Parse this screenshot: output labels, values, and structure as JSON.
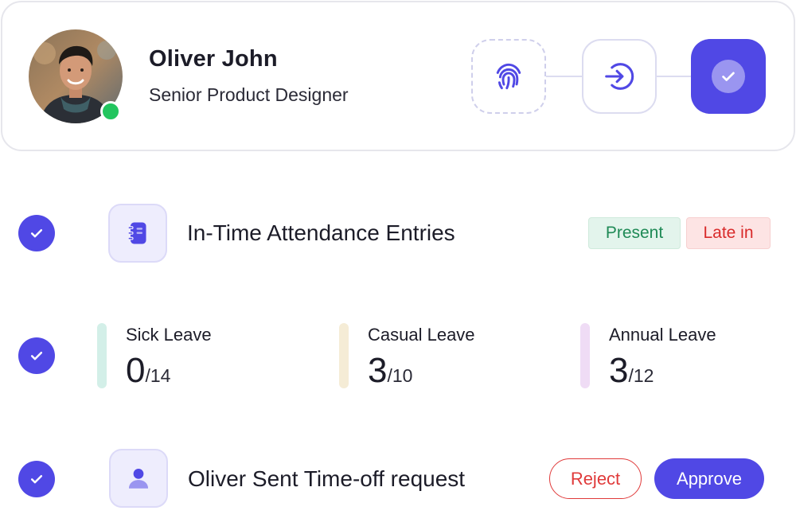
{
  "profile": {
    "name": "Oliver John",
    "role": "Senior Product Designer",
    "status": "online"
  },
  "steps": [
    {
      "icon": "fingerprint-icon",
      "state": "pending"
    },
    {
      "icon": "sign-in-icon",
      "state": "pending"
    },
    {
      "icon": "check-icon",
      "state": "complete"
    }
  ],
  "attendance": {
    "title": "In-Time Attendance Entries",
    "badges": {
      "present": "Present",
      "late": "Late in"
    }
  },
  "leaves": [
    {
      "label": "Sick Leave",
      "used": "0",
      "total": "/14",
      "color": "#d3efe8"
    },
    {
      "label": "Casual Leave",
      "used": "3",
      "total": "/10",
      "color": "#f5ecd6"
    },
    {
      "label": "Annual Leave",
      "used": "3",
      "total": "/12",
      "color": "#efdcf5"
    }
  ],
  "request": {
    "title": "Oliver Sent Time-off request",
    "reject_label": "Reject",
    "approve_label": "Approve"
  },
  "colors": {
    "accent": "#5048e5",
    "online": "#22c55e",
    "present": "#1f8a56",
    "late": "#d92b2b"
  }
}
